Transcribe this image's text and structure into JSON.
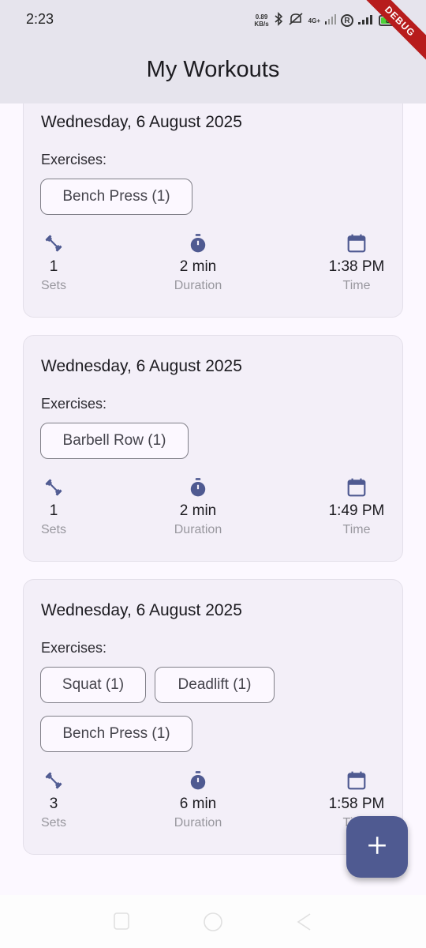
{
  "status_bar": {
    "time": "2:23",
    "net_speed_value": "0.89",
    "net_speed_unit": "KB/s",
    "network_type": "4G+",
    "battery": "84",
    "debug_banner": "DEBUG"
  },
  "app_bar": {
    "title": "My Workouts"
  },
  "labels": {
    "exercises": "Exercises:"
  },
  "workouts": [
    {
      "date": "Wednesday, 6 August 2025",
      "exercises": [
        "Bench Press (1)"
      ],
      "sets_value": "1",
      "sets_label": "Sets",
      "duration_value": "2 min",
      "duration_label": "Duration",
      "time_value": "1:38 PM",
      "time_label": "Time"
    },
    {
      "date": "Wednesday, 6 August 2025",
      "exercises": [
        "Barbell Row (1)"
      ],
      "sets_value": "1",
      "sets_label": "Sets",
      "duration_value": "2 min",
      "duration_label": "Duration",
      "time_value": "1:49 PM",
      "time_label": "Time"
    },
    {
      "date": "Wednesday, 6 August 2025",
      "exercises": [
        "Squat (1)",
        "Deadlift (1)",
        "Bench Press (1)"
      ],
      "sets_value": "3",
      "sets_label": "Sets",
      "duration_value": "6 min",
      "duration_label": "Duration",
      "time_value": "1:58 PM",
      "time_label": "Time"
    }
  ],
  "fab": {
    "icon": "plus-icon"
  },
  "colors": {
    "accent": "#4f5a91",
    "app_bar_bg": "#e6e4ed",
    "card_bg": "#f3eff8",
    "page_bg": "#fcf8ff"
  }
}
